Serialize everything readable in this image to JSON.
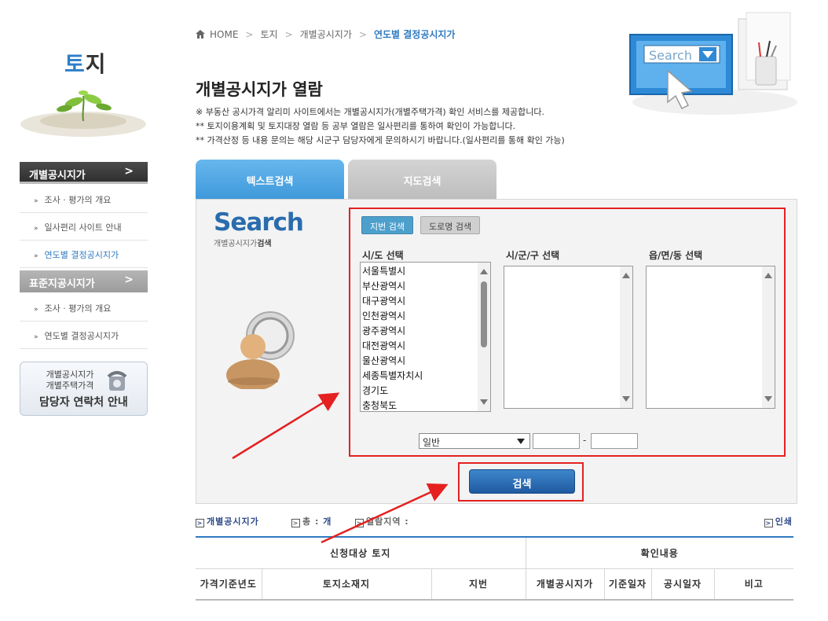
{
  "sidebar": {
    "title_part1": "토",
    "title_part2": "지",
    "group1": {
      "label": "개별공시지가",
      "items": [
        {
          "label": "조사 · 평가의 개요"
        },
        {
          "label": "일사편리 사이트 안내"
        },
        {
          "label": "연도별 결정공시지가"
        }
      ]
    },
    "group2": {
      "label": "표준지공시지가",
      "items": [
        {
          "label": "조사 · 평가의 개요"
        },
        {
          "label": "연도별 결정공시지가"
        }
      ]
    },
    "contact": {
      "line1": "개별공시지가",
      "line2": "개별주택가격",
      "line3": "담당자 연락처 안내"
    }
  },
  "breadcrumb": {
    "home": "HOME",
    "level1": "토지",
    "level2": "개별공시지가",
    "current": "연도별 결정공시지가"
  },
  "page": {
    "title": "개별공시지가 열람",
    "notes": [
      "※ 부동산 공시가격 알리미 사이트에서는 개별공시지가(개별주택가격) 확인 서비스를 제공합니다.",
      "** 토지이용계획 및 토지대장 열람 등 공부 열람은 일사편리를 통하여 확인이 가능합니다.",
      "** 가격산정 등 내용 문의는 해당 시군구 담당자에게 문의하시기 바랍니다.(일사편리를 통해 확인 가능)"
    ]
  },
  "decor": {
    "search_text": "Search"
  },
  "tabs": {
    "text_search": "텍스트검색",
    "map_search": "지도검색"
  },
  "search": {
    "logo": "Search",
    "subtitle_a": "개별공시지가",
    "subtitle_b": "검색",
    "btn_jibun": "지번 검색",
    "btn_road": "도로명 검색",
    "label_sido": "시/도 선택",
    "label_sigungu": "시/군/구 선택",
    "label_umd": "읍/면/동 선택",
    "sido_options": [
      "서울특별시",
      "부산광역시",
      "대구광역시",
      "인천광역시",
      "광주광역시",
      "대전광역시",
      "울산광역시",
      "세종특별자치시",
      "경기도",
      "충청북도"
    ],
    "type_select": "일반",
    "dash": "-",
    "button": "검색"
  },
  "results": {
    "label_main": "개별공시지가",
    "label_total": "총 :",
    "total_unit": "개",
    "label_area": "열람지역 :",
    "print": "인쇄"
  },
  "table": {
    "group_a": "신청대상 토지",
    "group_b": "확인내용",
    "columns": [
      "가격기준년도",
      "토지소재지",
      "지번",
      "개별공시지가",
      "기준일자",
      "공시일자",
      "비고"
    ]
  }
}
